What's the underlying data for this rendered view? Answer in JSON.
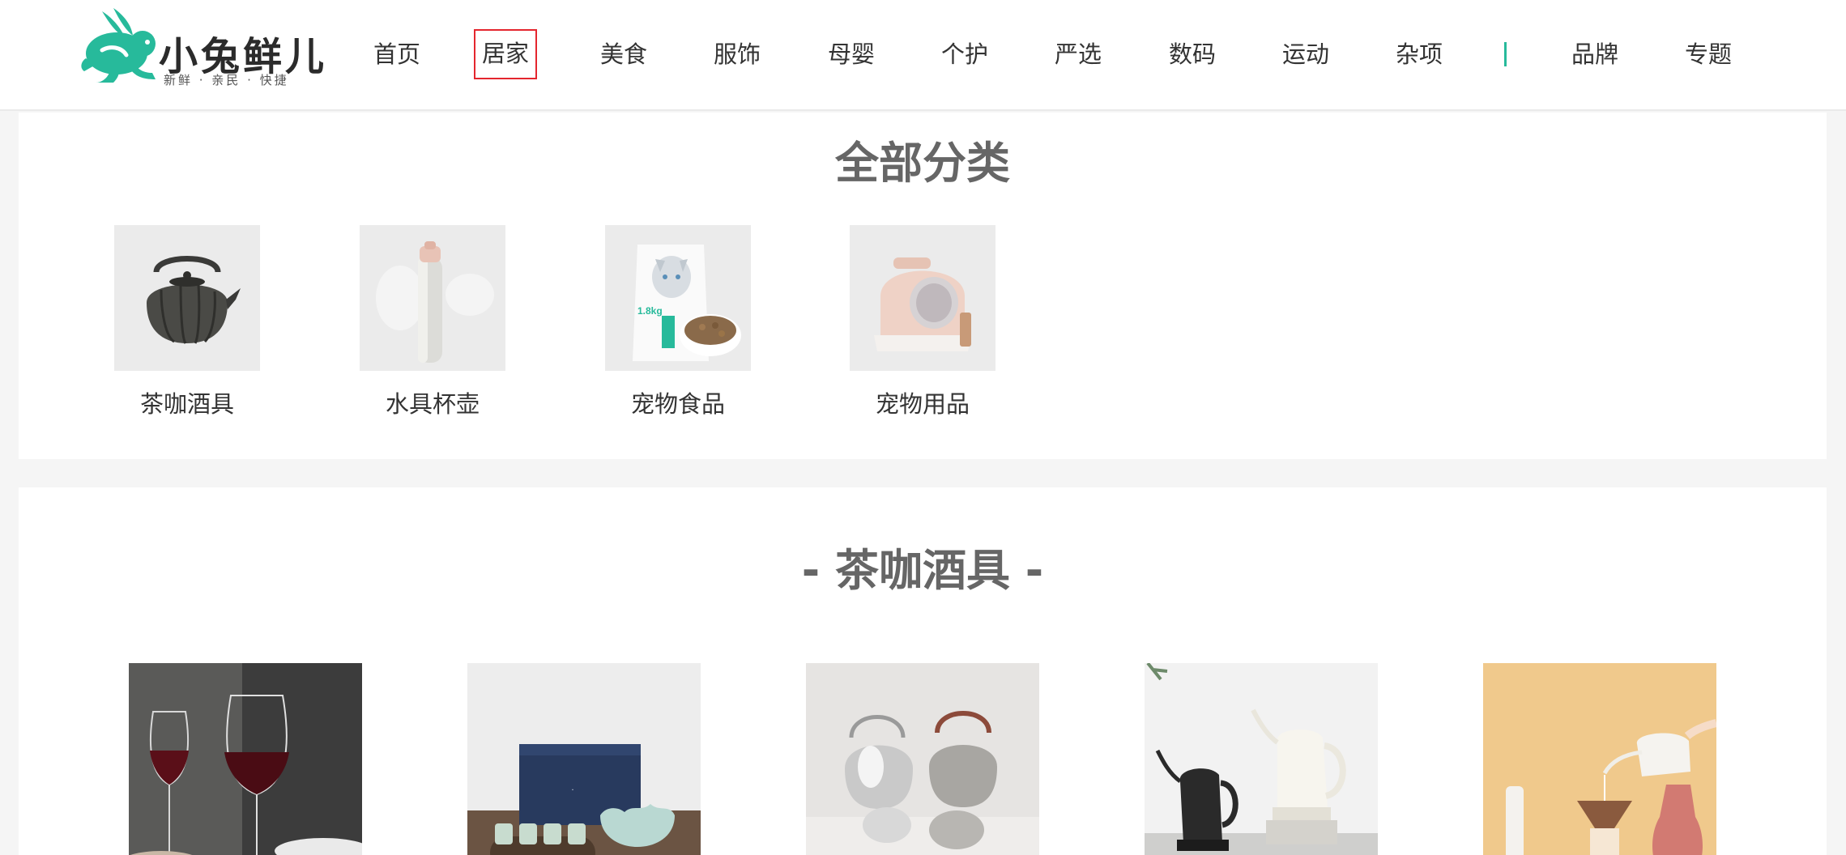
{
  "header": {
    "logo": {
      "title": "小兔鲜儿",
      "slogan": "新鲜 · 亲民 · 快捷",
      "icon": "rabbit-logo-icon",
      "brand_color": "#27ba9b"
    },
    "nav": [
      {
        "label": "首页",
        "active": false
      },
      {
        "label": "居家",
        "active": true
      },
      {
        "label": "美食",
        "active": false
      },
      {
        "label": "服饰",
        "active": false
      },
      {
        "label": "母婴",
        "active": false
      },
      {
        "label": "个护",
        "active": false
      },
      {
        "label": "严选",
        "active": false
      },
      {
        "label": "数码",
        "active": false
      },
      {
        "label": "运动",
        "active": false
      },
      {
        "label": "杂项",
        "active": false
      },
      {
        "label": "品牌",
        "active": false
      },
      {
        "label": "专题",
        "active": false
      }
    ],
    "active_color": "#e4262e"
  },
  "all_categories": {
    "title": "全部分类",
    "items": [
      {
        "label": "茶咖酒具",
        "icon": "teapot-image"
      },
      {
        "label": "水具杯壶",
        "icon": "thermos-bottle-image"
      },
      {
        "label": "宠物食品",
        "icon": "cat-food-bag-image"
      },
      {
        "label": "宠物用品",
        "icon": "cat-litter-box-image"
      }
    ]
  },
  "tea_section": {
    "title": "- 茶咖酒具 -",
    "products": [
      {
        "icon": "wine-glasses-image"
      },
      {
        "icon": "tea-cup-gift-set-image"
      },
      {
        "icon": "silver-teapots-image"
      },
      {
        "icon": "electric-kettles-image"
      },
      {
        "icon": "pour-over-kettle-image"
      }
    ]
  }
}
